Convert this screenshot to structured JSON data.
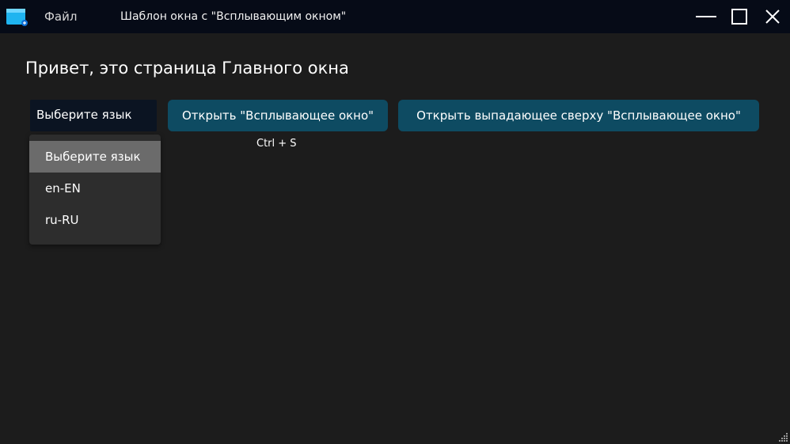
{
  "titlebar": {
    "file_menu": "Файл",
    "window_title": "Шаблон окна с \"Всплывающим окном\"",
    "icons": {
      "app": "app-window-icon",
      "minimize": "minimize-icon",
      "maximize": "maximize-icon",
      "close": "close-icon"
    }
  },
  "main": {
    "heading": "Привет, это страница Главного окна",
    "language_select": {
      "value": "Выберите язык",
      "options": [
        "Выберите язык",
        "en-EN",
        "ru-RU"
      ],
      "highlighted_index": 0
    },
    "open_popup_button": "Открыть \"Всплывающее окно\"",
    "open_popup_shortcut": "Ctrl + S",
    "open_top_popup_button": "Открыть выпадающее сверху \"Всплывающее окно\""
  },
  "colors": {
    "window_background": "#1c1c1c",
    "titlebar_background": "#060b17",
    "button_background": "#0e4b62",
    "dropdown_background": "#2d2d2d",
    "dropdown_highlight": "#6b6b6b",
    "select_background": "#0b1422"
  }
}
